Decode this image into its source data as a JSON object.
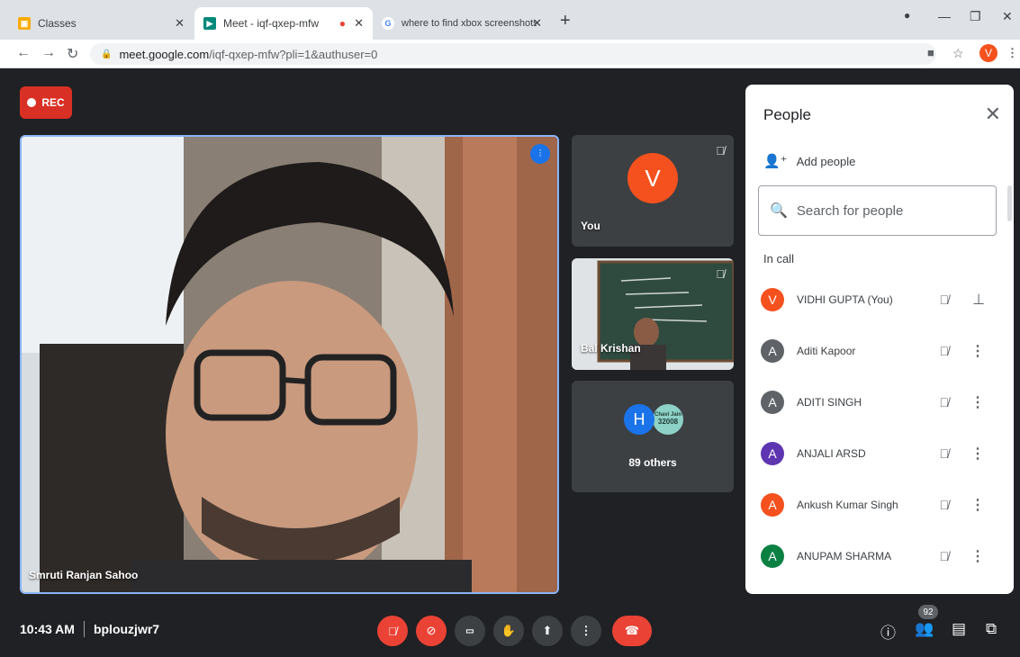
{
  "browser": {
    "tabs": [
      {
        "title": "Classes",
        "favicon": "classroom-icon"
      },
      {
        "title": "Meet - iqf-qxep-mfw",
        "favicon": "meet-icon",
        "recording_dot": "#ea4335"
      },
      {
        "title": "where to find xbox screenshots o",
        "favicon": "google-icon"
      }
    ],
    "url_host": "meet.google.com",
    "url_path": "/iqf-qxep-mfw?pli=1&authuser=0",
    "profile_initial": "V"
  },
  "meet": {
    "rec_label": "REC",
    "main_speaker": "Smruti Ranjan Sahoo",
    "tiles": [
      {
        "label": "You",
        "initial": "V"
      },
      {
        "label": "Bal Krishan"
      },
      {
        "label": "89 others",
        "initial": "H",
        "mini_text_1": "Chavi Jain",
        "mini_text_2": "32008"
      }
    ],
    "time": "10:43 AM",
    "meeting_code": "bplouzjwr7",
    "people_count": "92"
  },
  "people_panel": {
    "title": "People",
    "add_people_label": "Add people",
    "search_placeholder": "Search for people",
    "section_label": "In call",
    "people": [
      {
        "initial": "V",
        "name": "VIDHI GUPTA (You)",
        "color": "#f4511e"
      },
      {
        "initial": "A",
        "name": "Aditi Kapoor",
        "color": "#5f6368"
      },
      {
        "initial": "A",
        "name": "ADITI SINGH",
        "color": "#5f6368"
      },
      {
        "initial": "A",
        "name": "ANJALI ARSD",
        "color": "#5e35b1"
      },
      {
        "initial": "A",
        "name": "Ankush Kumar Singh",
        "color": "#f4511e"
      },
      {
        "initial": "A",
        "name": "ANUPAM SHARMA",
        "color": "#0b8043"
      }
    ]
  },
  "colors": {
    "accent": "#1a73e8",
    "danger": "#ea4335",
    "background": "#202124"
  }
}
